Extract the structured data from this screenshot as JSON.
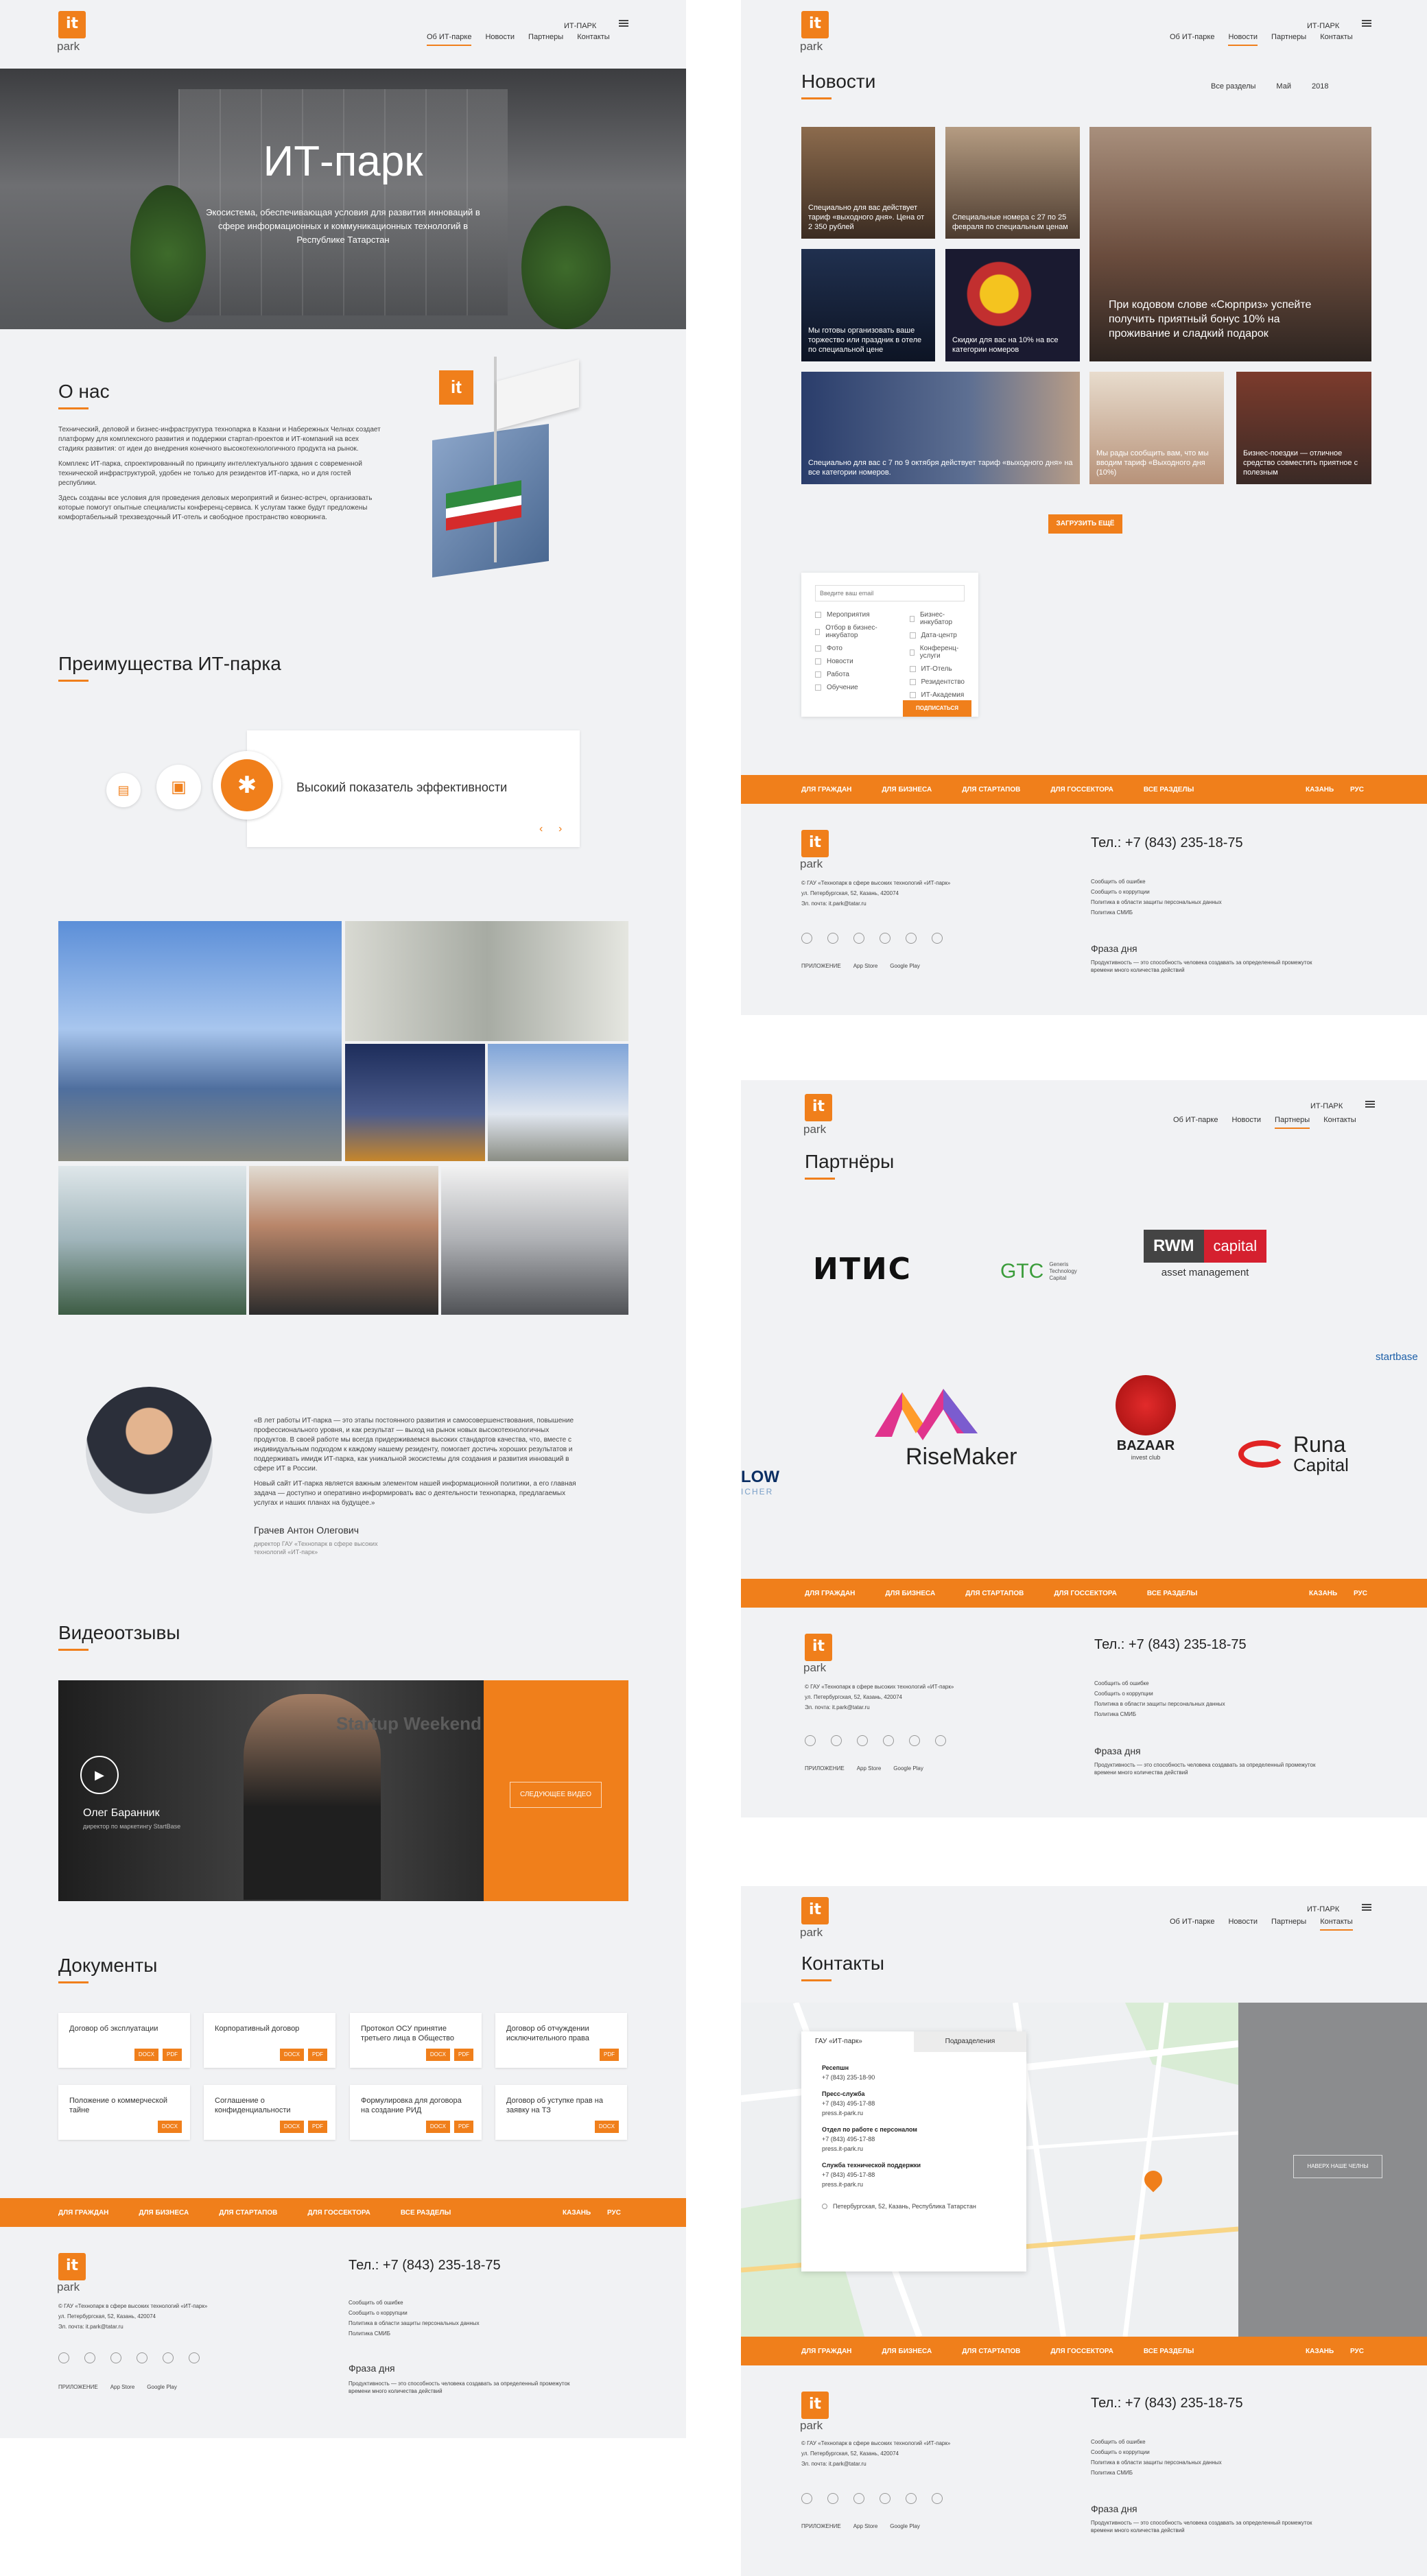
{
  "brand": {
    "logo_mark": "it",
    "logo_sub": "park"
  },
  "nav": {
    "lang": "ИТ-ПАРК",
    "items": [
      "Об ИТ-парке",
      "Новости",
      "Партнеры",
      "Контакты"
    ]
  },
  "hero": {
    "title": "ИТ-парк",
    "subtitle": "Экосистема, обеспечивающая условия для развития инноваций в сфере информационных и коммуникационных технологий в Республике Татарстан"
  },
  "about": {
    "title": "О нас",
    "p1": "Технический, деловой и бизнес-инфраструктура технопарка в Казани и Набережных Челнах создает платформу для комплексного развития и поддержки стартап-проектов и ИТ-компаний на всех стадиях развития: от идеи до внедрения конечного высокотехнологичного продукта на рынок.",
    "p2": "Комплекс ИТ-парка, спроектированный по принципу интеллектуального здания с современной технической инфраструктурой, удобен не только для резидентов ИТ-парка, но и для гостей республики.",
    "p3": "Здесь созданы все условия для проведения деловых мероприятий и бизнес-встреч, организовать которые помогут опытные специалисты конференц-сервиса. К услугам также будут предложены комфортабельный трехзвездочный ИТ-отель и свободное пространство коворкинга."
  },
  "advantages": {
    "title": "Преимущества ИТ-парка",
    "card_text": "Высокий показатель эффективности"
  },
  "quote": {
    "text1": "«В лет работы ИТ-парка — это этапы постоянного развития и самосовершенствования, повышение профессионального уровня, и как результат — выход на рынок новых высокотехнологичных продуктов. В своей работе мы всегда придерживаемся высоких стандартов качества, что, вместе с индивидуальным подходом к каждому нашему резиденту, помогает достичь хороших результатов и поддерживать имидж ИТ-парка, как уникальной экосистемы для создания и развития инноваций в сфере ИТ в России.",
    "text2": "Новый сайт ИТ-парка является важным элементом нашей информационной политики, а его главная задача — доступно и оперативно информировать вас о деятельности технопарка, предлагаемых услугах и наших планах на будущее.»",
    "name": "Грачев Антон Олегович",
    "position": "директор ГАУ «Технопарк в сфере высоких технологий «ИТ-парк»"
  },
  "video": {
    "title": "Видеоотзывы",
    "person": "Олег Баранник",
    "role": "директор по маркетингу StartBase",
    "next_button": "СЛЕДУЮЩЕЕ ВИДЕО",
    "overlay_text": "Startup Weekend"
  },
  "documents": {
    "title": "Документы",
    "items": [
      {
        "name": "Договор об эксплуатации",
        "tags": [
          "DOCX",
          "PDF"
        ]
      },
      {
        "name": "Корпоративный договор",
        "tags": [
          "DOCX",
          "PDF"
        ]
      },
      {
        "name": "Протокол ОСУ принятие третьего лица в Общество",
        "tags": [
          "DOCX",
          "PDF"
        ]
      },
      {
        "name": "Договор об отчуждении исключительного права",
        "tags": [
          "PDF"
        ]
      },
      {
        "name": "Положение о коммерческой тайне",
        "tags": [
          "DOCX"
        ]
      },
      {
        "name": "Соглашение о конфиденциальности",
        "tags": [
          "DOCX",
          "PDF"
        ]
      },
      {
        "name": "Формулировка для договора на создание РИД",
        "tags": [
          "DOCX",
          "PDF"
        ]
      },
      {
        "name": "Договор об уступке прав на заявку на ТЗ",
        "tags": [
          "DOCX"
        ]
      }
    ]
  },
  "footer": {
    "bar": [
      "ДЛЯ ГРАЖДАН",
      "ДЛЯ БИЗНЕСА",
      "ДЛЯ СТАРТАПОВ",
      "ДЛЯ ГОССЕКТОРА",
      "ВСЕ РАЗДЕЛЫ"
    ],
    "city": "КАЗАНЬ",
    "lang": "РУС",
    "org": "© ГАУ «Технопарк в сфере высоких технологий «ИТ-парк»",
    "address": "ул. Петербургская, 52, Казань, 420074",
    "email": "Эл. почта: it.park@tatar.ru",
    "phone": "Тел.: +7 (843) 235-18-75",
    "links": [
      "Сообщить об ошибке",
      "Сообщить о коррупции",
      "Политика в области защиты персональных данных",
      "Политика СМИБ"
    ],
    "app_label": "ПРИЛОЖЕНИЕ",
    "app_store": "App Store",
    "google_play": "Google Play",
    "phrase_title": "Фраза дня",
    "phrase": "Продуктивность — это способность человека создавать за определенный промежуток времени много количества действий"
  },
  "news": {
    "title": "Новости",
    "filters": [
      "Все разделы",
      "Май",
      "2018"
    ],
    "items": [
      "Специально для вас действует тариф «выходного дня». Цена от 2 350 рублей",
      "Специальные номера с 27 по 25 февраля по специальным ценам",
      "При кодовом слове «Сюрприз» успейте получить приятный бонус 10% на проживание и сладкий подарок",
      "Мы готовы организовать ваше торжество или праздник в отеле по специальной цене",
      "Скидки для вас на 10% на все категории номеров",
      "Специально для вас с 7 по 9 октября действует тариф «выходного дня» на все категории номеров.",
      "Мы рады сообщить вам, что мы вводим тариф «Выходного дня (10%)",
      "Бизнес-поездки — отличное средство совместить приятное с полезным"
    ],
    "load_more": "ЗАГРУЗИТЬ ЕЩЁ"
  },
  "subscribe": {
    "placeholder": "Введите ваш email",
    "col1": [
      "Мероприятия",
      "Отбор в бизнес-инкубатор",
      "Фото",
      "Новости",
      "Работа",
      "Обучение"
    ],
    "col2": [
      "Бизнес-инкубатор",
      "Дата-центр",
      "Конференц-услуги",
      "ИТ-Отель",
      "Резидентство",
      "ИТ-Академия"
    ],
    "button": "ПОДПИСАТЬСЯ"
  },
  "partners": {
    "title": "Партнёры",
    "logos": [
      "ИТИС",
      "GTC",
      "Generis Technology Capital",
      "RWM",
      "capital",
      "asset management",
      "startbase",
      "RiseMaker",
      "BAZAAR",
      "invest club",
      "Runa",
      "Capital",
      "LOW",
      "ICHER"
    ]
  },
  "contacts": {
    "title": "Контакты",
    "tabs": [
      "ГАУ «ИТ-парк»",
      "Подразделения"
    ],
    "reception_title": "Ресепшн",
    "reception_phone": "+7 (843) 235-18-90",
    "press_title": "Пресс-служба",
    "press_phone": "+7 (843) 495-17-88",
    "press_mail": "press.it-park.ru",
    "hr_title": "Отдел по работе с персоналом",
    "hr_phone": "+7 (843) 495-17-88",
    "hr_mail": "press.it-park.ru",
    "support_title": "Служба технической поддержки",
    "support_phone": "+7 (843) 495-17-88",
    "support_mail": "press.it-park.ru",
    "address": "Петербургская, 52, Казань, Республика Татарстан",
    "map_button": "НАВЕРХ НАШЕ ЧЕЛНЫ"
  },
  "colors": {
    "accent": "#f07f1b",
    "bg": "#f1f2f4"
  }
}
